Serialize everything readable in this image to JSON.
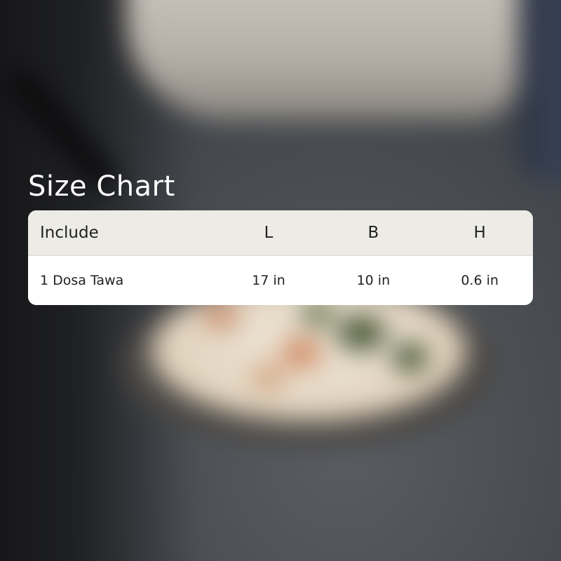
{
  "title": "Size Chart",
  "table": {
    "headers": {
      "include": "Include",
      "l": "L",
      "b": "B",
      "h": "H"
    },
    "rows": [
      {
        "include": "1 Dosa Tawa",
        "l": "17 in",
        "b": "10 in",
        "h": "0.6 in"
      }
    ]
  },
  "colors": {
    "title_text": "#ffffff",
    "header_bg": "#ecebe6",
    "body_bg": "#ffffff",
    "cell_text": "#222222"
  }
}
